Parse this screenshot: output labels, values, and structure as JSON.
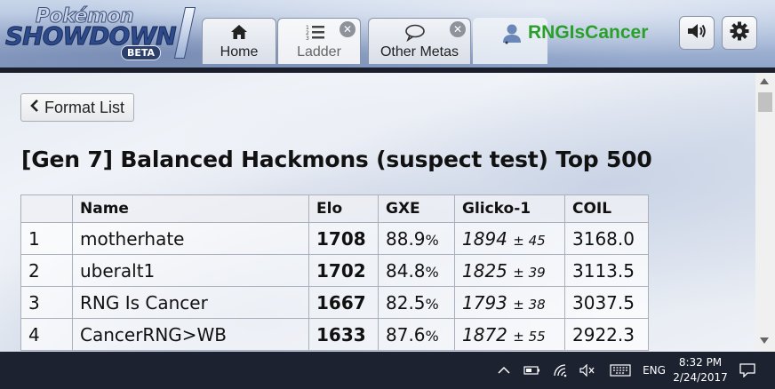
{
  "header": {
    "logo": {
      "top": "Pokémon",
      "main": "SHOWDOWN",
      "badge": "BETA"
    },
    "tabs": [
      {
        "label": "Home",
        "icon": "home-icon",
        "closable": false,
        "active": false
      },
      {
        "label": "Ladder",
        "icon": "ladder-list-icon",
        "closable": true,
        "active": true
      },
      {
        "label": "Other Metas",
        "icon": "chat-bubble-icon",
        "closable": true,
        "active": false
      }
    ],
    "username": "RNGIsCancer",
    "username_color": "#2aa02a",
    "sound_icon": "speaker-icon",
    "settings_icon": "gear-icon"
  },
  "main": {
    "back_button": "Format List",
    "title": "[Gen 7] Balanced Hackmons (suspect test) Top 500",
    "table": {
      "headers": [
        "",
        "Name",
        "Elo",
        "GXE",
        "Glicko-1",
        "COIL"
      ],
      "rows": [
        {
          "rank": "1",
          "name": "motherhate",
          "elo": "1708",
          "gxe": "88.9",
          "gxe_unit": "%",
          "glicko": "1894",
          "glicko_dev": "± 45",
          "coil": "3168.0"
        },
        {
          "rank": "2",
          "name": "uberalt1",
          "elo": "1702",
          "gxe": "84.8",
          "gxe_unit": "%",
          "glicko": "1825",
          "glicko_dev": "± 39",
          "coil": "3113.5"
        },
        {
          "rank": "3",
          "name": "RNG Is Cancer",
          "elo": "1667",
          "gxe": "82.5",
          "gxe_unit": "%",
          "glicko": "1793",
          "glicko_dev": "± 38",
          "coil": "3037.5"
        },
        {
          "rank": "4",
          "name": "CancerRNG>WB",
          "elo": "1633",
          "gxe": "87.6",
          "gxe_unit": "%",
          "glicko": "1872",
          "glicko_dev": "± 55",
          "coil": "2922.3"
        }
      ]
    }
  },
  "taskbar": {
    "icons": [
      "chevron-up-icon",
      "battery-icon",
      "wifi-icon",
      "volume-muted-icon",
      "keyboard-icon"
    ],
    "language": "ENG",
    "time": "8:32 PM",
    "date": "2/24/2017",
    "notification_icon": "action-center-icon"
  }
}
